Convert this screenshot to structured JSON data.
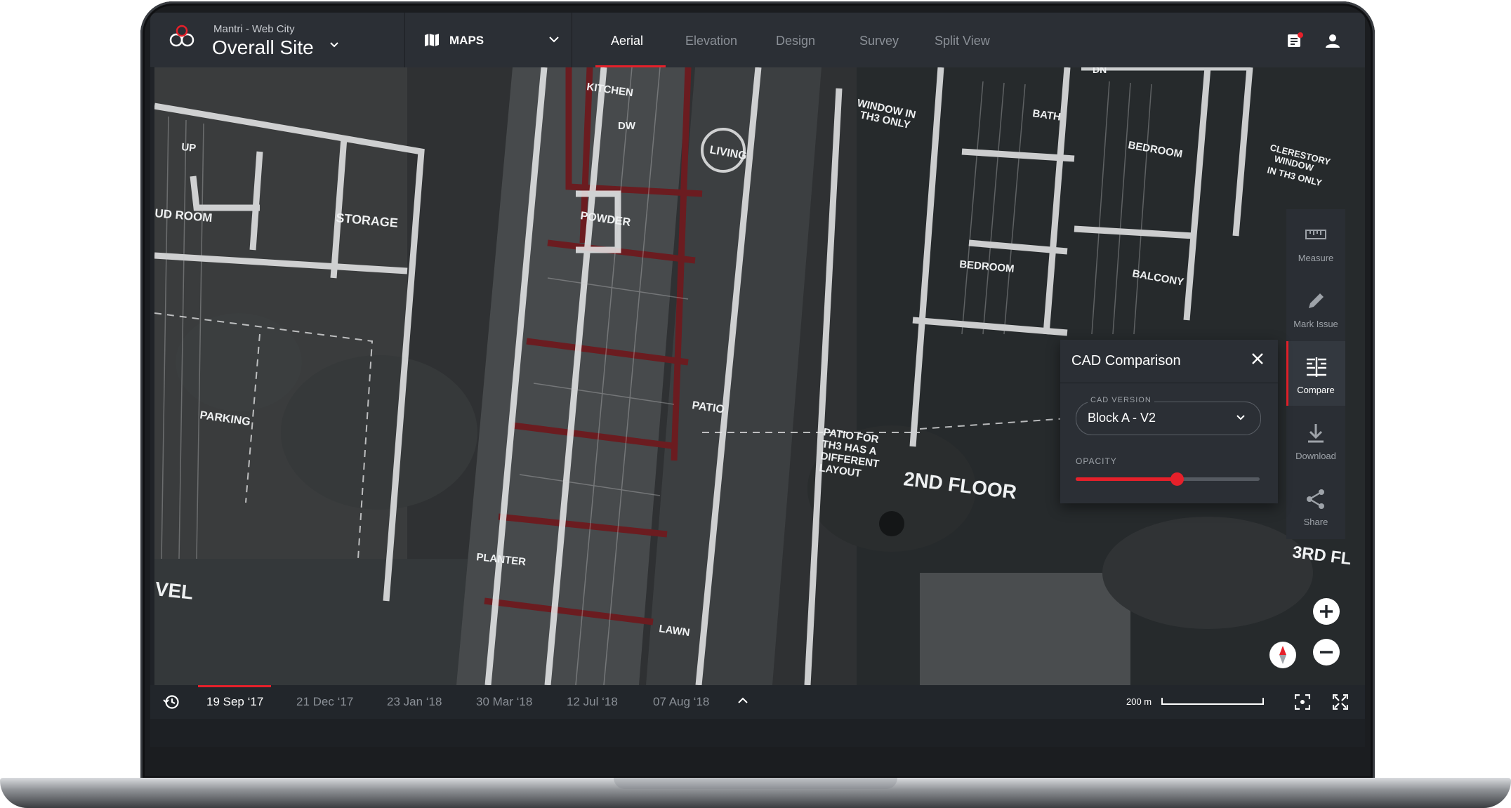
{
  "header": {
    "project": "Mantri - Web City",
    "site": "Overall Site",
    "maps_label": "MAPS",
    "tabs": [
      "Aerial",
      "Elevation",
      "Design",
      "Survey",
      "Split View"
    ],
    "active_tab": "Aerial"
  },
  "map_labels": {
    "kitchen": "KITCHEN",
    "dw": "DW",
    "living": "LIVING",
    "up": "UP",
    "ud_room": "UD ROOM",
    "storage": "STORAGE",
    "powder": "POWDER",
    "parking": "PARKING",
    "patio": "PATIO",
    "planter": "PLANTER",
    "lawn": "LAWN",
    "vel": "VEL",
    "window_line1": "WINDOW IN",
    "window_line2": "TH3 ONLY",
    "patio_note_1": "PATIO FOR",
    "patio_note_2": "TH3 HAS A",
    "patio_note_3": "DIFFERENT",
    "patio_note_4": "LAYOUT",
    "second_floor": "2ND FLOOR",
    "third_floor": "3RD FL",
    "bath": "BATH",
    "bedroom_a": "BEDROOM",
    "bedroom_b": "BEDROOM",
    "balcony": "BALCONY",
    "clerestory_1": "CLERESTORY",
    "clerestory_2": "WINDOW",
    "clerestory_3": "IN TH3 ONLY",
    "dn": "DN"
  },
  "tools": {
    "measure": "Measure",
    "mark_issue": "Mark Issue",
    "compare": "Compare",
    "download": "Download",
    "share": "Share"
  },
  "cad_panel": {
    "title": "CAD Comparison",
    "version_label": "CAD VERSION",
    "version_value": "Block A - V2",
    "opacity_label": "OPACITY",
    "opacity": 0.55
  },
  "timeline": {
    "dates": [
      "19 Sep ‘17",
      "21 Dec ‘17",
      "23 Jan ‘18",
      "30 Mar ‘18",
      "12 Jul ‘18",
      "07 Aug ‘18"
    ],
    "active_date": "19 Sep ‘17",
    "scale": "200 m"
  },
  "colors": {
    "accent": "#e6202a",
    "chrome": "#2b2f35",
    "text_muted": "#8b9097"
  }
}
